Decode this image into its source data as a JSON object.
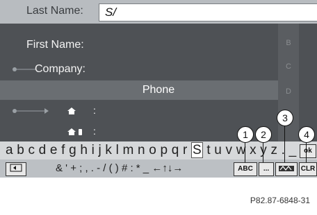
{
  "fields": {
    "last_name_label": "Last Name:",
    "last_name_value": "S/",
    "first_name_label": "First Name:",
    "company_label": "Company:"
  },
  "section": {
    "phone_heading": "Phone"
  },
  "alpha_index": [
    "B",
    "C",
    "D"
  ],
  "phone_rows": [
    {
      "icon": "home-icon",
      "value": ":"
    },
    {
      "icon": "home-mobile-icon",
      "value": ":"
    }
  ],
  "keyboard": {
    "letters_before": "a b c d e f g h i j k l m n o p q r ",
    "selected_letter": "S",
    "letters_after": " t u v w x y z . _ ",
    "ok_label": "ok",
    "symbols": "& ' + ; , . - / ( ) # : * _ ←↑↓→",
    "abc_label": "ABC",
    "more_label": "...",
    "clr_label": "CLR"
  },
  "callouts": [
    "1",
    "2",
    "3",
    "4"
  ],
  "reference_code": "P82.87-6848-31"
}
